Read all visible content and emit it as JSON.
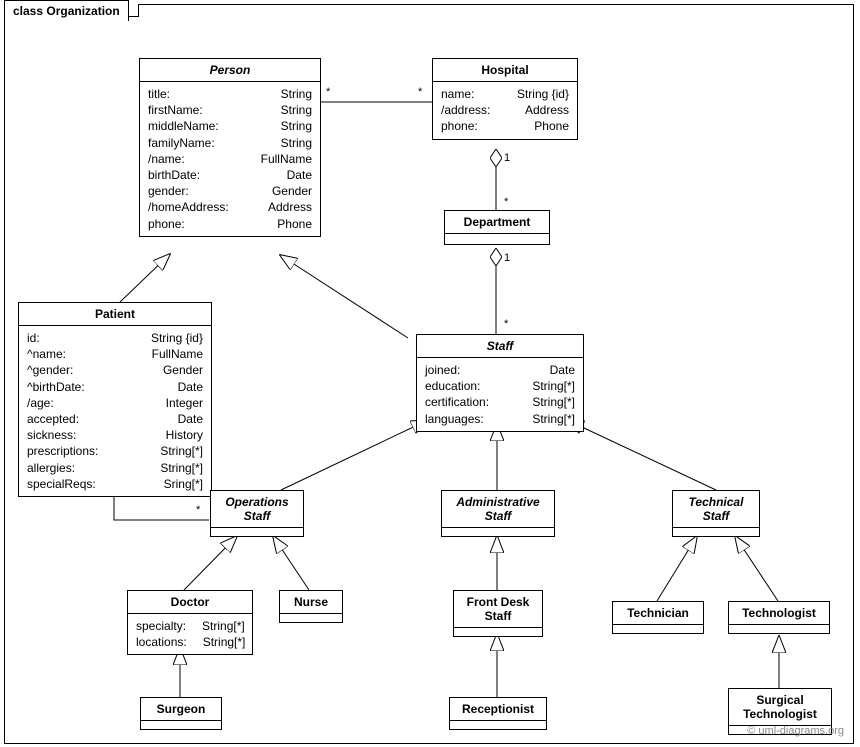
{
  "title": "class Organization",
  "credit": "© uml-diagrams.org",
  "classes": {
    "person": {
      "name": "Person",
      "attrs": [
        [
          "title:",
          "String"
        ],
        [
          "firstName:",
          "String"
        ],
        [
          "middleName:",
          "String"
        ],
        [
          "familyName:",
          "String"
        ],
        [
          "/name:",
          "FullName"
        ],
        [
          "birthDate:",
          "Date"
        ],
        [
          "gender:",
          "Gender"
        ],
        [
          "/homeAddress:",
          "Address"
        ],
        [
          "phone:",
          "Phone"
        ]
      ]
    },
    "hospital": {
      "name": "Hospital",
      "attrs": [
        [
          "name:",
          "String {id}"
        ],
        [
          "/address:",
          "Address"
        ],
        [
          "phone:",
          "Phone"
        ]
      ]
    },
    "department": {
      "name": "Department"
    },
    "patient": {
      "name": "Patient",
      "attrs": [
        [
          "id:",
          "String {id}"
        ],
        [
          "^name:",
          "FullName"
        ],
        [
          "^gender:",
          "Gender"
        ],
        [
          "^birthDate:",
          "Date"
        ],
        [
          "/age:",
          "Integer"
        ],
        [
          "accepted:",
          "Date"
        ],
        [
          "sickness:",
          "History"
        ],
        [
          "prescriptions:",
          "String[*]"
        ],
        [
          "allergies:",
          "String[*]"
        ],
        [
          "specialReqs:",
          "Sring[*]"
        ]
      ]
    },
    "staff": {
      "name": "Staff",
      "attrs": [
        [
          "joined:",
          "Date"
        ],
        [
          "education:",
          "String[*]"
        ],
        [
          "certification:",
          "String[*]"
        ],
        [
          "languages:",
          "String[*]"
        ]
      ]
    },
    "opstaff": {
      "name": "Operations Staff"
    },
    "adminstaff": {
      "name": "Administrative Staff"
    },
    "techstaff": {
      "name": "Technical Staff"
    },
    "doctor": {
      "name": "Doctor",
      "attrs": [
        [
          "specialty:",
          "String[*]"
        ],
        [
          "locations:",
          "String[*]"
        ]
      ]
    },
    "nurse": {
      "name": "Nurse"
    },
    "frontdesk": {
      "name": "Front Desk Staff"
    },
    "receptionist": {
      "name": "Receptionist"
    },
    "technician": {
      "name": "Technician"
    },
    "technologist": {
      "name": "Technologist"
    },
    "surgeon": {
      "name": "Surgeon"
    },
    "surgtech": {
      "name": "Surgical Technologist"
    }
  },
  "mult": {
    "one1": "1",
    "star1": "*",
    "one2": "1",
    "star2": "*",
    "star3": "*",
    "star4": "*",
    "star5": "*"
  }
}
